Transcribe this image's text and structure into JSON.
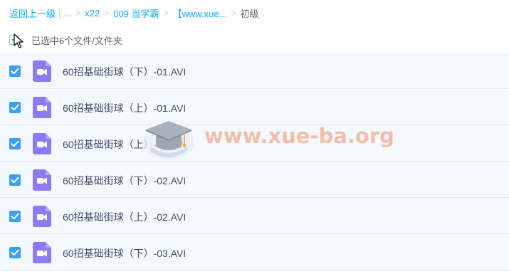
{
  "breadcrumb": {
    "back": "返回上一级",
    "ellipsis": "...",
    "items": [
      "x22",
      "009 当学霸",
      "【www.xue..."
    ],
    "current": "初级",
    "separator": ">",
    "bar": "|"
  },
  "selection": {
    "label": "已选中6个文件/文件夹"
  },
  "files": [
    {
      "name": "60招基础街球（下）-01.AVI",
      "checked": true,
      "icon": "video-file-icon"
    },
    {
      "name": "60招基础街球（上）-01.AVI",
      "checked": true,
      "icon": "video-file-icon"
    },
    {
      "name": "60招基础街球（上）-03.AVI",
      "checked": true,
      "icon": "video-file-icon"
    },
    {
      "name": "60招基础街球（下）-02.AVI",
      "checked": true,
      "icon": "video-file-icon"
    },
    {
      "name": "60招基础街球（上）-02.AVI",
      "checked": true,
      "icon": "video-file-icon"
    },
    {
      "name": "60招基础街球（下）-03.AVI",
      "checked": true,
      "icon": "video-file-icon"
    }
  ],
  "watermark": {
    "text": "www.xue-ba.org"
  },
  "colors": {
    "link": "#09aaff",
    "checkbox": "#3b9ffa",
    "row_bg": "#f3f9fe",
    "file_icon": "#8d7af5",
    "watermark": "#f3b49a"
  }
}
